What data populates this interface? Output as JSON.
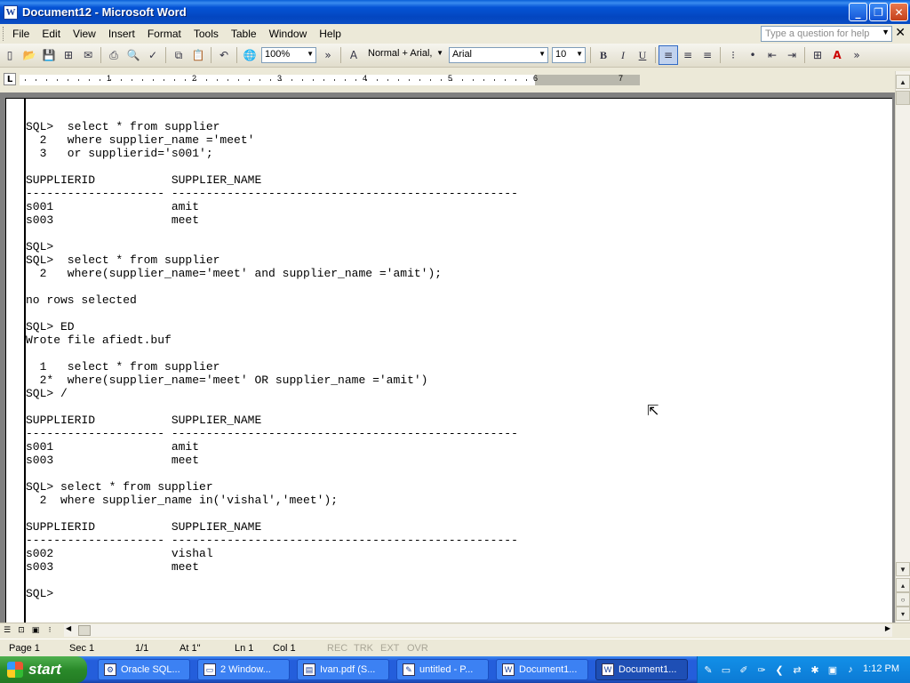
{
  "window": {
    "title": "Document12 - Microsoft Word",
    "app_icon": "W"
  },
  "menu": [
    "File",
    "Edit",
    "View",
    "Insert",
    "Format",
    "Tools",
    "Table",
    "Window",
    "Help"
  ],
  "help_placeholder": "Type a question for help",
  "toolbar": {
    "zoom": "100%",
    "style": "Normal + Arial,",
    "font": "Arial",
    "size": "10",
    "bold": "B",
    "italic": "I",
    "underline": "U",
    "font_color_label": "A"
  },
  "ruler": {
    "numbers": [
      "1",
      "2",
      "3",
      "4",
      "5",
      "6",
      "7"
    ]
  },
  "document_lines": [
    "SQL>  select * from supplier",
    "  2   where supplier_name ='meet'",
    "  3   or supplierid='s001';",
    "",
    "SUPPLIERID           SUPPLIER_NAME",
    "-------------------- --------------------------------------------------",
    "s001                 amit",
    "s003                 meet",
    "",
    "SQL>",
    "SQL>  select * from supplier",
    "  2   where(supplier_name='meet' and supplier_name ='amit');",
    "",
    "no rows selected",
    "",
    "SQL> ED",
    "Wrote file afiedt.buf",
    "",
    "  1   select * from supplier",
    "  2*  where(supplier_name='meet' OR supplier_name ='amit')",
    "SQL> /",
    "",
    "SUPPLIERID           SUPPLIER_NAME",
    "-------------------- --------------------------------------------------",
    "s001                 amit",
    "s003                 meet",
    "",
    "SQL> select * from supplier",
    "  2  where supplier_name in('vishal','meet');",
    "",
    "SUPPLIERID           SUPPLIER_NAME",
    "-------------------- --------------------------------------------------",
    "s002                 vishal",
    "s003                 meet",
    "",
    "SQL>"
  ],
  "status": {
    "page": "Page 1",
    "sec": "Sec 1",
    "pages": "1/1",
    "at": "At 1\"",
    "ln": "Ln 1",
    "col": "Col 1",
    "rec": "REC",
    "trk": "TRK",
    "ext": "EXT",
    "ovr": "OVR"
  },
  "taskbar": {
    "start": "start",
    "tasks": [
      "Oracle SQL...",
      "2 Window...",
      "Ivan.pdf (S...",
      "untitled - P...",
      "Document1...",
      "Document1..."
    ],
    "clock": "1:12 PM"
  }
}
